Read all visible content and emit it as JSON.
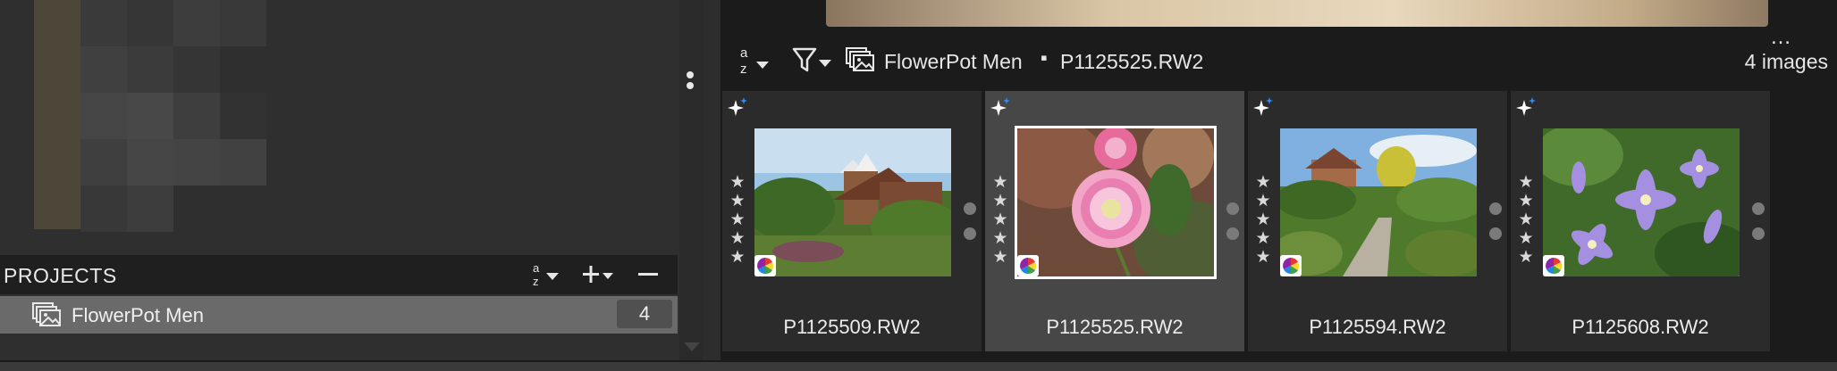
{
  "projects_panel": {
    "title": "PROJECTS",
    "sort_icon": "sort-az-icon",
    "add_icon": "plus-icon",
    "remove_icon": "minus-icon",
    "items": [
      {
        "name": "FlowerPot Men",
        "count": "4",
        "icon": "stacked-images-icon"
      }
    ]
  },
  "browser_toolbar": {
    "sort_icon": "sort-az-icon",
    "filter_icon": "filter-icon",
    "project_icon": "stacked-images-icon",
    "project_name": "FlowerPot Men",
    "separator": "▪",
    "current_file": "P1125525.RW2",
    "more_label": "…",
    "image_count": "4 images"
  },
  "filmstrip": {
    "images": [
      {
        "filename": "P1125509.RW2",
        "selected": false,
        "scene": "oast-house-garden"
      },
      {
        "filename": "P1125525.RW2",
        "selected": true,
        "scene": "pink-daisy"
      },
      {
        "filename": "P1125594.RW2",
        "selected": false,
        "scene": "cottage-path"
      },
      {
        "filename": "P1125608.RW2",
        "selected": false,
        "scene": "purple-clematis"
      }
    ]
  },
  "colors": {
    "background": "#2d2d2d",
    "panel_dark": "#1b1b1b",
    "selected_row": "#6a6a6a",
    "selected_cell": "#474747",
    "sparkle_blue": "#2d8cff"
  }
}
